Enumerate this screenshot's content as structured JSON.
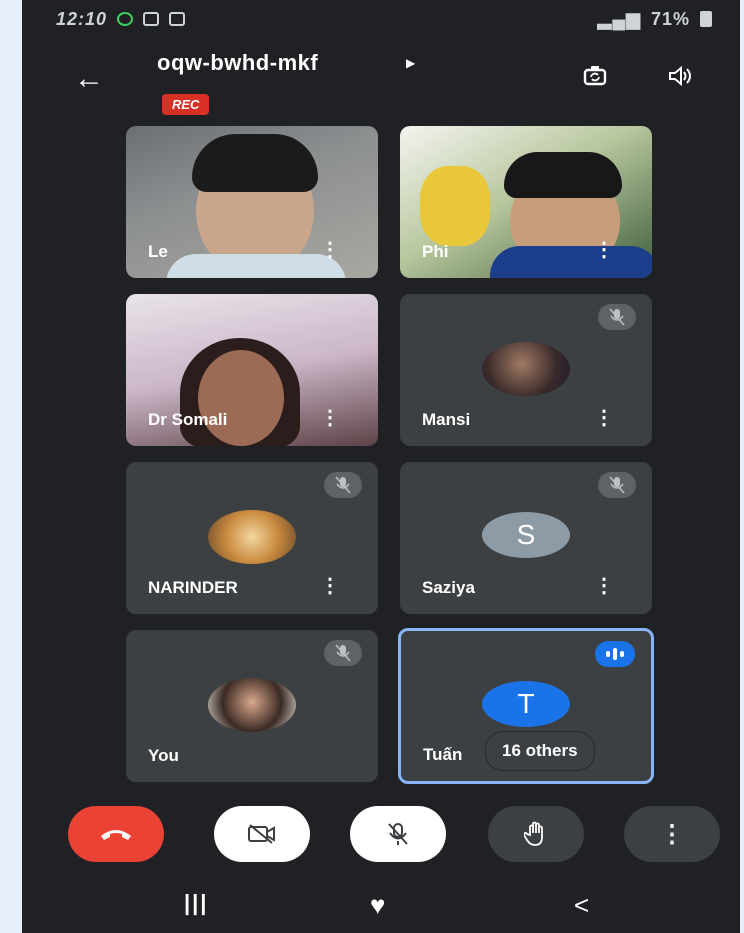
{
  "status_bar": {
    "time": "12:10",
    "battery": "71%"
  },
  "meeting": {
    "code": "oqw-bwhd-mkf",
    "rec_badge": "REC"
  },
  "participants": [
    {
      "name": "Le",
      "video": true,
      "muted": false
    },
    {
      "name": "Phi",
      "video": true,
      "muted": false
    },
    {
      "name": "Dr Somali",
      "video": true,
      "muted": false
    },
    {
      "name": "Mansi",
      "video": false,
      "muted": true
    },
    {
      "name": "NARINDER",
      "video": false,
      "muted": true
    },
    {
      "name": "Saziya",
      "video": false,
      "muted": true,
      "initial": "S"
    },
    {
      "name": "You",
      "video": false,
      "muted": true
    },
    {
      "name": "Tuấn",
      "video": false,
      "muted": false,
      "speaking": true,
      "initial": "T"
    }
  ],
  "others_label": "16 others",
  "icons": {
    "back": "arrow-left-icon",
    "camera_switch": "camera-switch-icon",
    "speaker": "speaker-icon",
    "mic_off": "mic-off-icon",
    "more": "more-vert-icon",
    "end_call": "phone-hangup-icon",
    "camera_off": "camera-off-icon",
    "raise_hand": "hand-icon"
  },
  "colors": {
    "background": "#202124",
    "tile": "#3c4043",
    "end_call": "#ea4335",
    "accent_blue": "#1a73e8",
    "rec_red": "#d93025",
    "saziya_avatar": "#8d9ba6",
    "tuan_avatar": "#1a73e8"
  }
}
